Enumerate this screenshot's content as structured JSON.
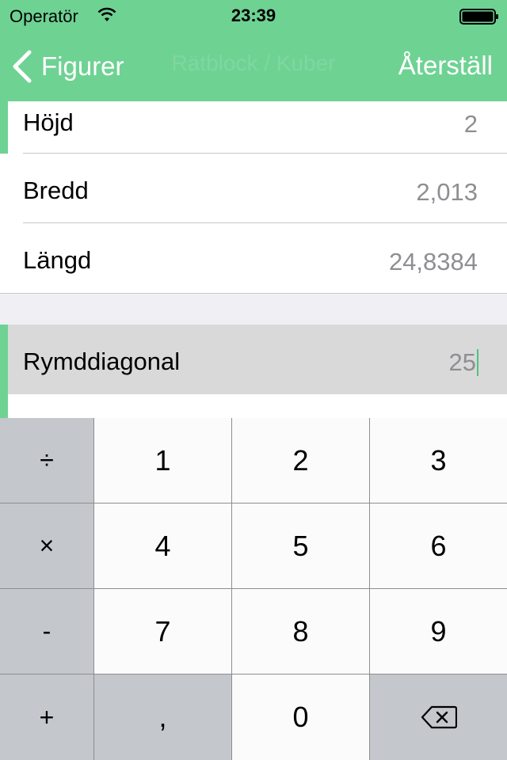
{
  "status_bar": {
    "carrier": "Operatör",
    "time": "23:39",
    "icons": [
      "wifi-icon",
      "battery-icon"
    ]
  },
  "nav": {
    "back_label": "Figurer",
    "title": "Rätblock / Kuber",
    "reset_label": "Återställ",
    "icons": [
      "chevron-left-icon"
    ]
  },
  "fields": [
    {
      "label": "Höjd",
      "value": "2"
    },
    {
      "label": "Bredd",
      "value": "2,013"
    },
    {
      "label": "Längd",
      "value": "24,8384"
    }
  ],
  "active_field": {
    "label": "Rymddiagonal",
    "value": "25"
  },
  "keypad": {
    "keys": [
      "÷",
      "1",
      "2",
      "3",
      "×",
      "4",
      "5",
      "6",
      "-",
      "7",
      "8",
      "9",
      "+",
      ",",
      "0"
    ],
    "backspace_icon": "backspace-icon"
  },
  "colors": {
    "accent": "#6ed293",
    "value_gray": "#8e8e93",
    "active_row": "#d9d9d9",
    "key_dark": "#c4c7cb",
    "key_light": "#fbfbfb"
  }
}
